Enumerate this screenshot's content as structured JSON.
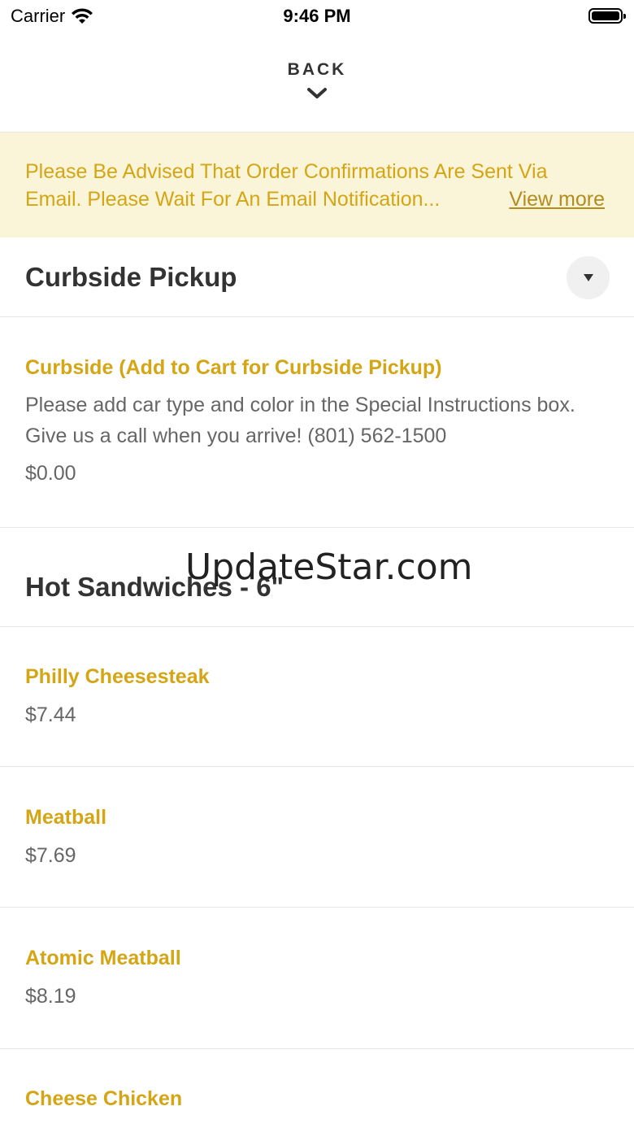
{
  "status_bar": {
    "carrier": "Carrier",
    "time": "9:46 PM"
  },
  "header": {
    "back_label": "BACK"
  },
  "notice": {
    "line1": "Please Be Advised That Order Confirmations Are Sent Via",
    "line2": "Email. Please Wait For An Email Notification...",
    "view_more": "View more"
  },
  "sections": [
    {
      "title": "Curbside Pickup",
      "items": [
        {
          "name": "Curbside (Add to Cart for Curbside Pickup)",
          "description": "Please add car type and color in the Special Instructions box. Give us a call when you arrive! (801) 562-1500",
          "price": "$0.00"
        }
      ]
    },
    {
      "title": "Hot Sandwiches - 6\"",
      "items": [
        {
          "name": "Philly Cheesesteak",
          "price": "$7.44"
        },
        {
          "name": "Meatball",
          "price": "$7.69"
        },
        {
          "name": "Atomic Meatball",
          "price": "$8.19"
        },
        {
          "name": "Cheese Chicken",
          "price": ""
        }
      ]
    }
  ],
  "watermark": "UpdateStar.com",
  "colors": {
    "accent": "#d4a514",
    "notice_bg": "#faf5d9",
    "text": "#333333",
    "muted": "#666666"
  }
}
